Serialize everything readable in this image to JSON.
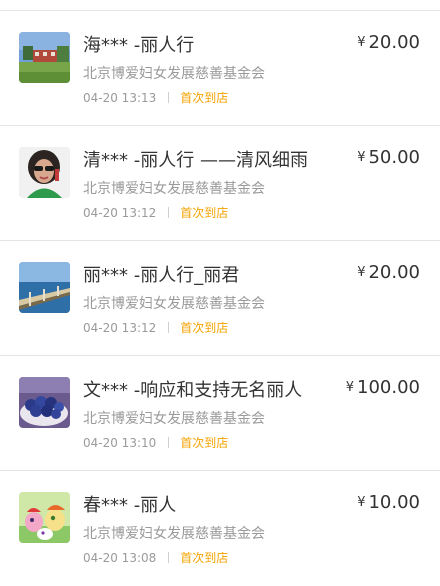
{
  "donations": [
    {
      "avatar_icon": "landscape-avatar",
      "donor": "海*** -丽人行",
      "organization": "北京博爱妇女发展慈善基金会",
      "time": "04-20 13:13",
      "tag": "首次到店",
      "currency": "¥",
      "amount": "20.00"
    },
    {
      "avatar_icon": "portrait-avatar",
      "donor": "清*** -丽人行 ——清风细雨",
      "organization": "北京博爱妇女发展慈善基金会",
      "time": "04-20 13:12",
      "tag": "首次到店",
      "currency": "¥",
      "amount": "50.00"
    },
    {
      "avatar_icon": "bridge-sea-avatar",
      "donor": "丽*** -丽人行_丽君",
      "organization": "北京博爱妇女发展慈善基金会",
      "time": "04-20 13:12",
      "tag": "首次到店",
      "currency": "¥",
      "amount": "20.00"
    },
    {
      "avatar_icon": "blueberries-avatar",
      "donor": "文*** -响应和支持无名丽人",
      "organization": "北京博爱妇女发展慈善基金会",
      "time": "04-20 13:10",
      "tag": "首次到店",
      "currency": "¥",
      "amount": "100.00"
    },
    {
      "avatar_icon": "cartoon-pony-avatar",
      "donor": "春*** -丽人",
      "organization": "北京博爱妇女发展慈善基金会",
      "time": "04-20 13:08",
      "tag": "首次到店",
      "currency": "¥",
      "amount": "10.00"
    }
  ]
}
